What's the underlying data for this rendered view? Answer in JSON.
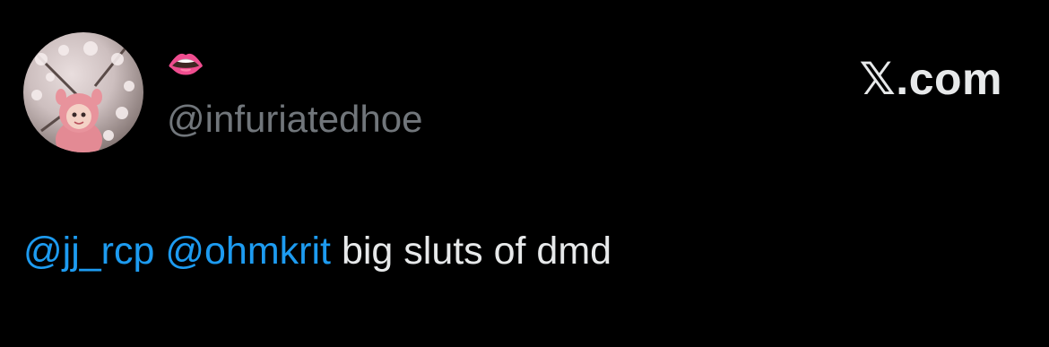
{
  "user": {
    "display_name": "👄",
    "handle": "@infuriatedhoe"
  },
  "brand": {
    "label": ".com",
    "x_glyph": "𝕏"
  },
  "tweet": {
    "mentions": [
      "@jj_rcp",
      "@ohmkrit"
    ],
    "text": "big sluts of dmd"
  },
  "colors": {
    "background": "#000000",
    "text": "#e7e9ea",
    "muted": "#71767b",
    "mention": "#1d9bf0"
  }
}
